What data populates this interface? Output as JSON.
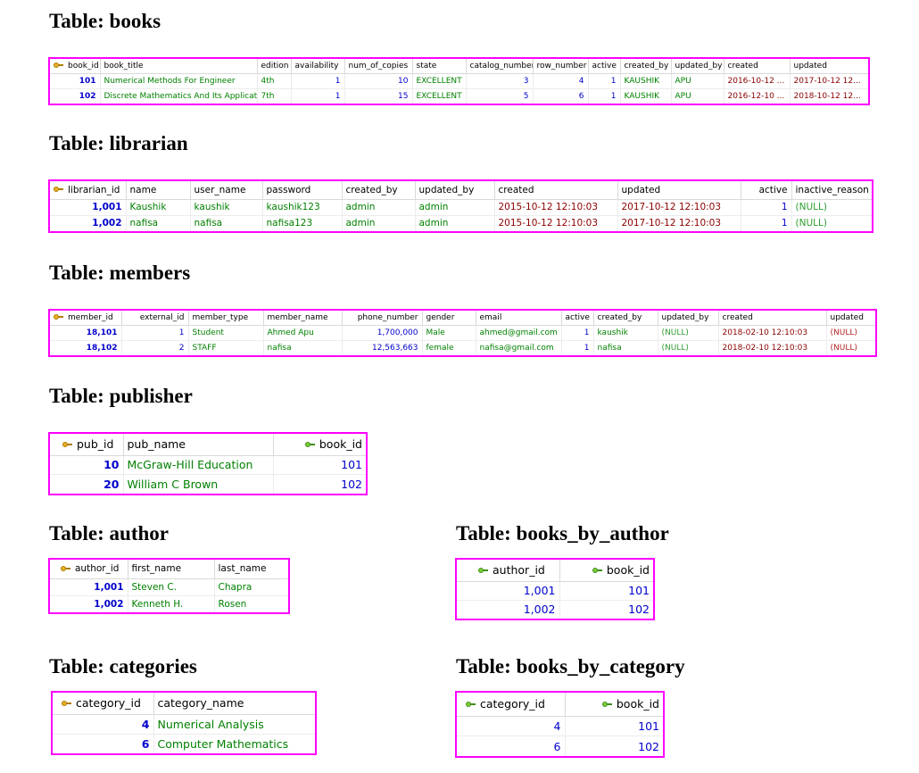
{
  "titles": {
    "books": "Table: books",
    "librarian": "Table: librarian",
    "members": "Table: members",
    "publisher": "Table: publisher",
    "author": "Table: author",
    "books_by_author": "Table: books_by_author",
    "categories": "Table: categories",
    "books_by_category": "Table: books_by_category"
  },
  "books": {
    "headers": [
      "book_id",
      "book_title",
      "edition",
      "availability",
      "num_of_copies",
      "state",
      "catalog_number",
      "row_number",
      "active",
      "created_by",
      "updated_by",
      "created",
      "updated"
    ],
    "rows": [
      [
        "101",
        "Numerical Methods For Engineer",
        "4th",
        "1",
        "10",
        "EXCELLENT",
        "3",
        "4",
        "1",
        "KAUSHIK",
        "APU",
        "2016-10-12 ...",
        "2017-10-12 12..."
      ],
      [
        "102",
        "Discrete Mathematics And Its Application",
        "7th",
        "1",
        "15",
        "EXCELLENT",
        "5",
        "6",
        "1",
        "KAUSHIK",
        "APU",
        "2016-12-10 ...",
        "2018-10-12 12..."
      ]
    ]
  },
  "librarian": {
    "headers": [
      "librarian_id",
      "name",
      "user_name",
      "password",
      "created_by",
      "updated_by",
      "created",
      "updated",
      "active",
      "inactive_reason"
    ],
    "rows": [
      [
        "1,001",
        "Kaushik",
        "kaushik",
        "kaushik123",
        "admin",
        "admin",
        "2015-10-12 12:10:03",
        "2017-10-12 12:10:03",
        "1",
        "(NULL)"
      ],
      [
        "1,002",
        "nafisa",
        "nafisa",
        "nafisa123",
        "admin",
        "admin",
        "2015-10-12 12:10:03",
        "2017-10-12 12:10:03",
        "1",
        "(NULL)"
      ]
    ]
  },
  "members": {
    "headers": [
      "member_id",
      "external_id",
      "member_type",
      "member_name",
      "phone_number",
      "gender",
      "email",
      "active",
      "created_by",
      "updated_by",
      "created",
      "updated"
    ],
    "rows": [
      [
        "18,101",
        "1",
        "Student",
        "Ahmed Apu",
        "1,700,000",
        "Male",
        "ahmed@gmail.com",
        "1",
        "kaushik",
        "(NULL)",
        "2018-02-10 12:10:03",
        "(NULL)"
      ],
      [
        "18,102",
        "2",
        "STAFF",
        "nafisa",
        "12,563,663",
        "female",
        "nafisa@gmail.com",
        "1",
        "nafisa",
        "(NULL)",
        "2018-02-10 12:10:03",
        "(NULL)"
      ]
    ]
  },
  "publisher": {
    "headers": [
      "pub_id",
      "pub_name",
      "book_id"
    ],
    "rows": [
      [
        "10",
        "McGraw-Hill Education",
        "101"
      ],
      [
        "20",
        "William C Brown",
        "102"
      ]
    ]
  },
  "author": {
    "headers": [
      "author_id",
      "first_name",
      "last_name"
    ],
    "rows": [
      [
        "1,001",
        "Steven C.",
        "Chapra"
      ],
      [
        "1,002",
        "Kenneth H.",
        "Rosen"
      ]
    ]
  },
  "books_by_author": {
    "headers": [
      "author_id",
      "book_id"
    ],
    "rows": [
      [
        "1,001",
        "101"
      ],
      [
        "1,002",
        "102"
      ]
    ]
  },
  "categories": {
    "headers": [
      "category_id",
      "category_name"
    ],
    "rows": [
      [
        "4",
        "Numerical Analysis"
      ],
      [
        "6",
        "Computer Mathematics"
      ]
    ]
  },
  "books_by_category": {
    "headers": [
      "category_id",
      "book_id"
    ],
    "rows": [
      [
        "4",
        "101"
      ],
      [
        "6",
        "102"
      ]
    ]
  }
}
